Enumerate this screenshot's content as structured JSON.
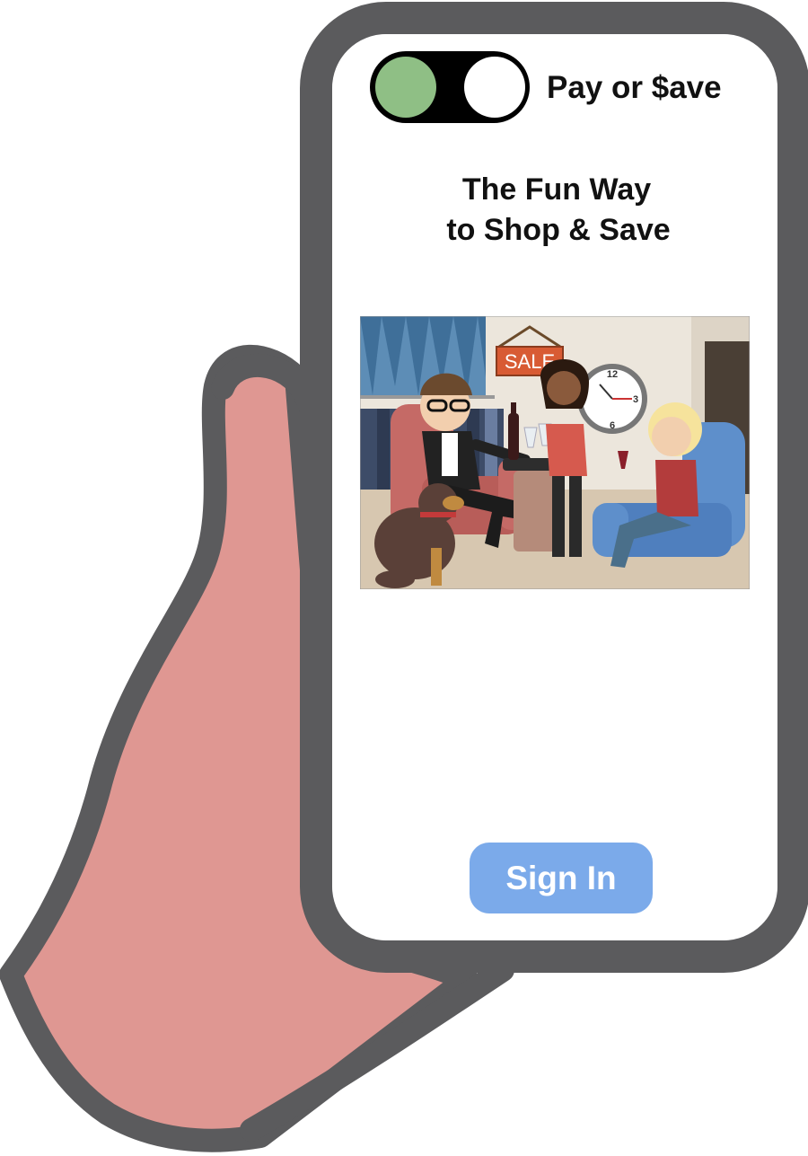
{
  "app": {
    "brand": "Pay or $ave",
    "toggle": {
      "state": "pay",
      "active_color": "#8fbf85",
      "track_color": "#000000",
      "knob_color": "#ffffff"
    }
  },
  "hero": {
    "title_line1": "The Fun Way",
    "title_line2": "to Shop & Save"
  },
  "illustration": {
    "sale_sign": "SALE",
    "clock_numbers": [
      "12",
      "3",
      "6"
    ]
  },
  "actions": {
    "sign_in_label": "Sign In",
    "sign_in_color": "#7baaea"
  },
  "colors": {
    "phone_frame": "#5b5b5d",
    "screen": "#ffffff",
    "hand": "#df9792"
  }
}
